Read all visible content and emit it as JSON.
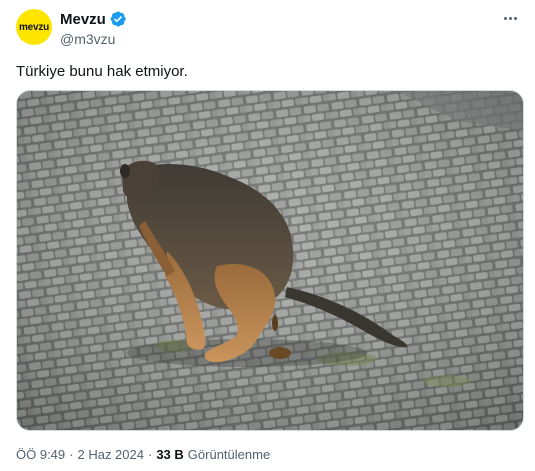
{
  "author": {
    "avatar_text": "mevzu",
    "name": "Mevzu",
    "handle": "@m3vzu",
    "verified": true
  },
  "tweet": {
    "text": "Türkiye bunu hak etmiyor."
  },
  "media": {
    "subject": "dog-on-cobblestone-street"
  },
  "meta": {
    "time": "ÖÖ 9:49",
    "separator": "·",
    "date": "2 Haz 2024",
    "views_count": "33 B",
    "views_label": "Görüntülenme"
  },
  "colors": {
    "brand_yellow": "#fde500",
    "verified_blue": "#1d9bf0",
    "secondary_text": "#536471"
  }
}
